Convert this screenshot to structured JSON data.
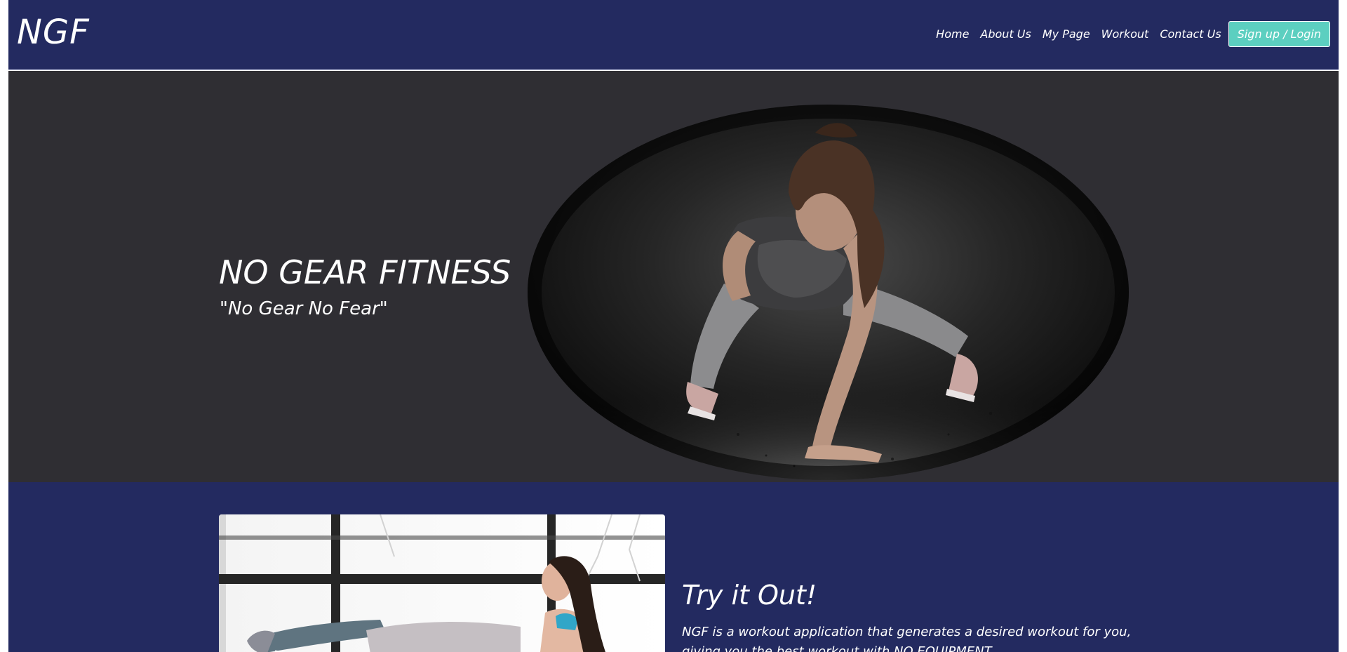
{
  "nav": {
    "brand": "NGF",
    "links": [
      "Home",
      "About Us",
      "My Page",
      "Workout",
      "Contact Us"
    ],
    "cta": "Sign up / Login"
  },
  "hero": {
    "title": "NO GEAR FITNESS",
    "tagline": "\"No Gear No Fear\""
  },
  "try_section": {
    "title": "Try it Out!",
    "text": "NGF is a workout application that generates a desired workout for you, giving you the best workout with NO EQUIPMENT."
  },
  "colors": {
    "nav_bg": "#232a60",
    "hero_bg": "#2f2e33",
    "cta_bg": "#5ccfc0"
  }
}
